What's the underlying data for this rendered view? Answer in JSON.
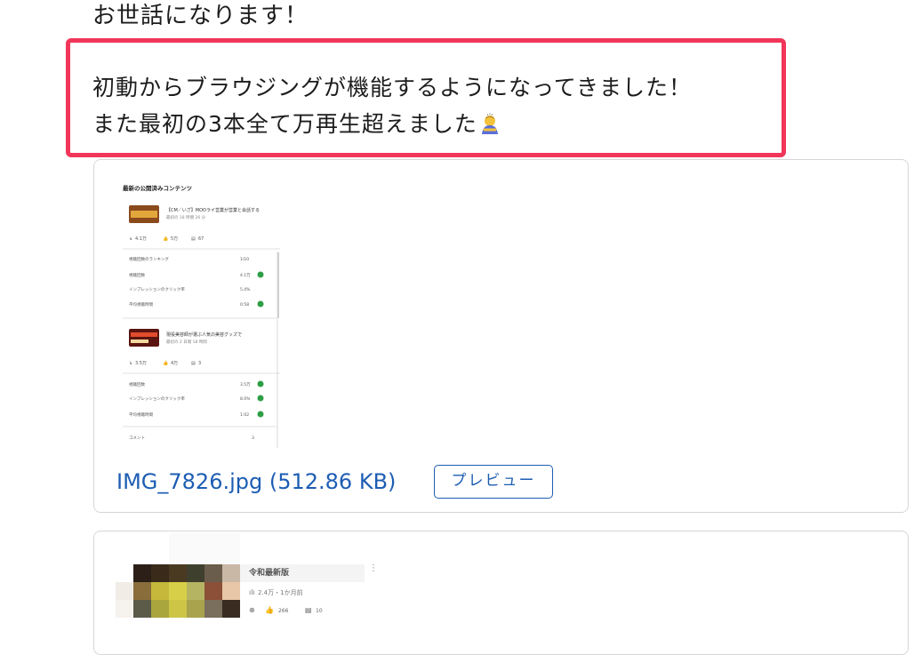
{
  "message": {
    "greeting": "お世話になります！",
    "highlighted_lines": [
      "初動からブラウジングが機能するようになってきました！",
      "また最初の3本全て万再生超えました"
    ],
    "emoji": "person-bowing-emoji"
  },
  "attachment": {
    "file_link": "IMG_7826.jpg (512.86 KB)",
    "preview_button": "プレビュー",
    "image": {
      "heading": "最新の公開済みコンテンツ",
      "video1": {
        "title": "【CM／いざ】MOOライ営業が営業と会話する",
        "meta": "最初の 18 時間 26 分",
        "stats": {
          "views": "4.1万",
          "likes": "5万",
          "comments": "67"
        },
        "ranking_label": "視聴回数のランキング",
        "ranking_value": "1/10",
        "rows": [
          {
            "label": "視聴回数",
            "value": "4.1万"
          },
          {
            "label": "インプレッションのクリック率",
            "value": "5.4%"
          },
          {
            "label": "平均視聴時間",
            "value": "0:58"
          }
        ]
      },
      "video2": {
        "title": "現役美容師が選ぶ人気の美容グッズで",
        "meta": "最初の 2 日間 18 時間",
        "stats": {
          "views": "3.5万",
          "likes": "4万",
          "comments": "3"
        },
        "rows": [
          {
            "label": "視聴回数",
            "value": "3.5万"
          },
          {
            "label": "インプレッションのクリック率",
            "value": "8.0%"
          },
          {
            "label": "平均視聴時間",
            "value": "1:02"
          }
        ],
        "comments_label": "コメント",
        "comments_value": "3"
      }
    }
  },
  "attachment2": {
    "title": "令和最新版",
    "meta": "2.4万・1か月前",
    "likes": "266",
    "comments": "10"
  }
}
